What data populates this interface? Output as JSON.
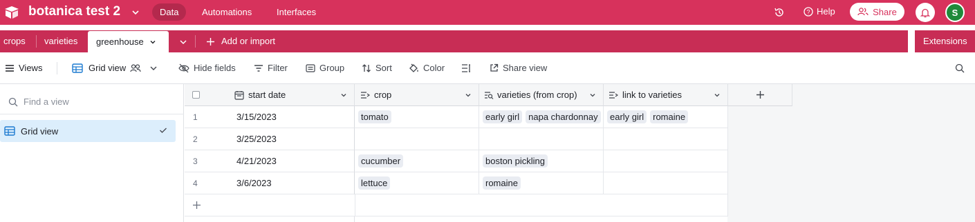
{
  "app": {
    "base_name": "botanica test 2",
    "brand_color": "#d7325c",
    "nav": [
      {
        "label": "Data",
        "active": true
      },
      {
        "label": "Automations",
        "active": false
      },
      {
        "label": "Interfaces",
        "active": false
      }
    ],
    "help_label": "Help",
    "share_label": "Share",
    "avatar_initial": "S"
  },
  "tabs": {
    "items": [
      {
        "label": "crops",
        "active": false
      },
      {
        "label": "varieties",
        "active": false
      },
      {
        "label": "greenhouse",
        "active": true
      }
    ],
    "add_label": "Add or import",
    "extensions_label": "Extensions"
  },
  "viewbar": {
    "views_label": "Views",
    "view_name": "Grid view",
    "hide_fields": "Hide fields",
    "filter": "Filter",
    "group": "Group",
    "sort": "Sort",
    "color": "Color",
    "share_view": "Share view"
  },
  "sidebar": {
    "find_placeholder": "Find a view",
    "views": [
      {
        "label": "Grid view",
        "selected": true
      }
    ]
  },
  "table": {
    "columns": [
      {
        "label": "start date",
        "icon": "calendar-icon"
      },
      {
        "label": "crop",
        "icon": "link-icon"
      },
      {
        "label": "varieties (from crop)",
        "icon": "lookup-icon"
      },
      {
        "label": "link to varieties",
        "icon": "link-icon"
      }
    ],
    "rows": [
      {
        "num": "1",
        "start_date": "3/15/2023",
        "crop": [
          "tomato"
        ],
        "varieties": [
          "early girl",
          "napa chardonnay"
        ],
        "links": [
          "early girl",
          "romaine"
        ]
      },
      {
        "num": "2",
        "start_date": "3/25/2023",
        "crop": [],
        "varieties": [],
        "links": []
      },
      {
        "num": "3",
        "start_date": "4/21/2023",
        "crop": [
          "cucumber"
        ],
        "varieties": [
          "boston pickling"
        ],
        "links": []
      },
      {
        "num": "4",
        "start_date": "3/6/2023",
        "crop": [
          "lettuce"
        ],
        "varieties": [
          "romaine"
        ],
        "links": []
      }
    ]
  }
}
